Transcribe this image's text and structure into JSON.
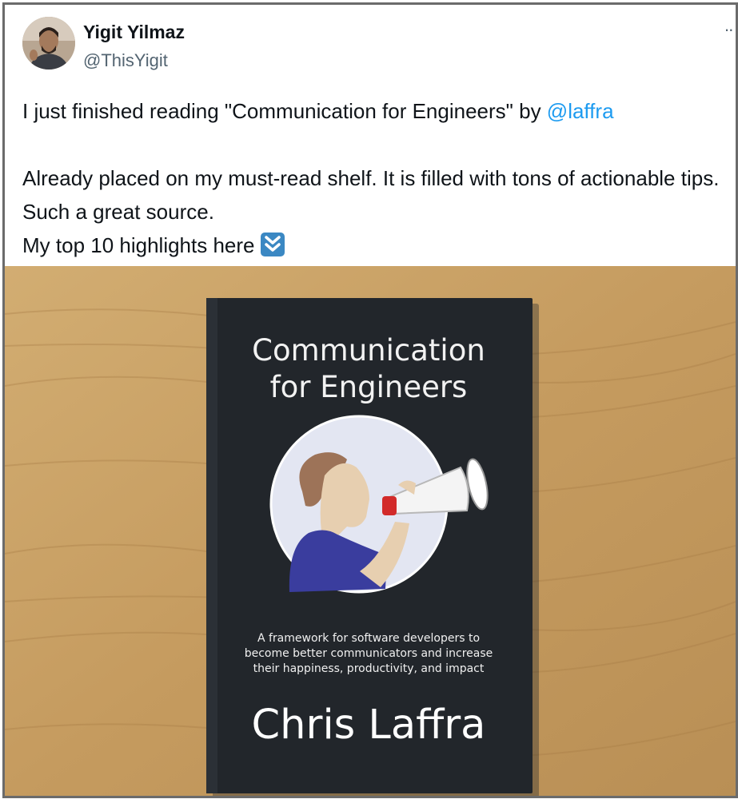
{
  "tweet": {
    "author_name": "Yigit Yilmaz",
    "author_handle": "@ThisYigit",
    "more_label": "··",
    "text_line1_prefix": "I just finished reading \"Communication for Engineers\" by ",
    "text_line1_mention": "@laffra",
    "text_para2": "Already placed on my must-read shelf. It is filled with tons of actionable tips. Such a great source.",
    "text_para3": "My top 10 highlights here",
    "emoji_icon": "double-down-arrow-icon"
  },
  "book": {
    "title_line1": "Communication",
    "title_line2": "for Engineers",
    "subtitle_line1": "A framework for software developers to",
    "subtitle_line2": "become better communicators and increase",
    "subtitle_line3": "their happiness, productivity, and impact",
    "author": "Chris Laffra"
  },
  "colors": {
    "text_primary": "#0f1419",
    "text_secondary": "#536471",
    "link": "#1d9bf0",
    "book_cover": "#22262b",
    "table_wood": "#c99f63"
  }
}
